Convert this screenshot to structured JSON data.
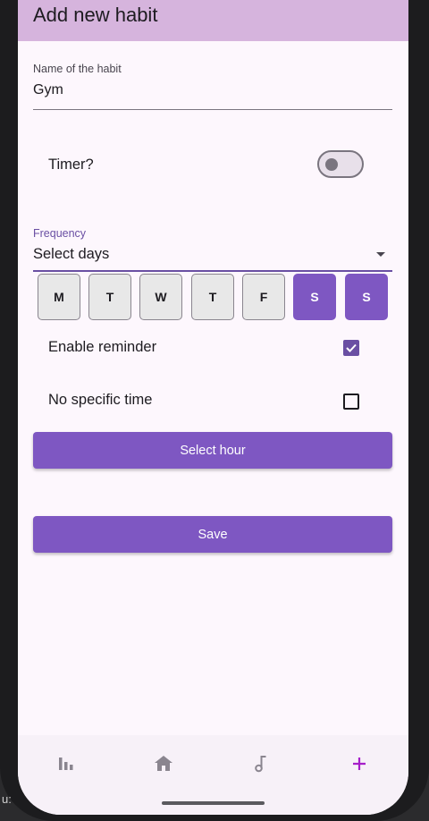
{
  "appbar": {
    "title": "Add new habit"
  },
  "name_field": {
    "label": "Name of the habit",
    "value": "Gym"
  },
  "timer": {
    "label": "Timer?",
    "enabled": false
  },
  "frequency": {
    "label": "Frequency",
    "value": "Select days",
    "days": [
      {
        "label": "M",
        "selected": false
      },
      {
        "label": "T",
        "selected": false
      },
      {
        "label": "W",
        "selected": false
      },
      {
        "label": "T",
        "selected": false
      },
      {
        "label": "F",
        "selected": false
      },
      {
        "label": "S",
        "selected": true
      },
      {
        "label": "S",
        "selected": true
      }
    ]
  },
  "reminder": {
    "label": "Enable reminder",
    "checked": true
  },
  "no_specific_time": {
    "label": "No specific time",
    "checked": false
  },
  "buttons": {
    "select_hour": "Select hour",
    "save": "Save"
  },
  "bottom_nav": {
    "items": [
      {
        "icon": "bar-chart-icon"
      },
      {
        "icon": "home-icon"
      },
      {
        "icon": "music-note-icon"
      },
      {
        "icon": "plus-icon",
        "active": true
      }
    ]
  },
  "status_fragment": "u:",
  "colors": {
    "appbar": "#d6b4dd",
    "primary": "#7e57c2",
    "accent_plus": "#a61fc9",
    "background": "#fdf7fd"
  }
}
